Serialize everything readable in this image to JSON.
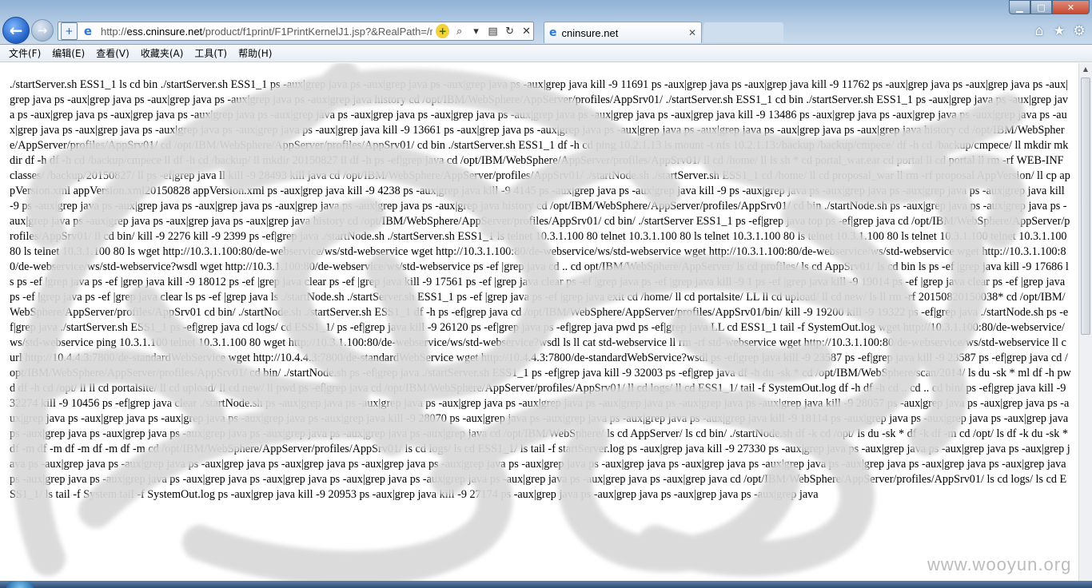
{
  "browser": {
    "url": "http://ess.cninsure.net/product/f1print/F1PrintKernelJ1.jsp?&RealPath=/roc",
    "url_domain": "ess.cninsure.net",
    "tab_title": "cninsure.net"
  },
  "menu": {
    "items": [
      "文件(F)",
      "编辑(E)",
      "查看(V)",
      "收藏夹(A)",
      "工具(T)",
      "帮助(H)"
    ]
  },
  "content": {
    "text": "./startServer.sh ESS1_1 ls cd bin ./startServer.sh ESS1_1 ps -aux|grep java ps -aux|grep java ps -aux|grep java ps -aux|grep java kill -9 11691 ps -aux|grep java ps -aux|grep java kill -9 11762 ps -aux|grep java ps -aux|grep java ps -aux|grep java ps -aux|grep java ps -aux|grep java ps -aux|grep java ps -aux|grep java history cd /opt/IBM/WebSphere/AppServer/profiles/AppSrv01/ ./startServer.sh ESS1_1 cd bin ./startServer.sh ESS1_1 ps -aux|grep java ps -aux|grep java ps -aux|grep java ps -aux|grep java ps -aux|grep java ps -aux|grep java ps -aux|grep java ps -aux|grep java ps -aux|grep java ps -aux|grep java ps -aux|grep java kill -9 13486 ps -aux|grep java ps -aux|grep java ps -aux|grep java ps -aux|grep java ps -aux|grep java ps -aux|grep java ps -aux|grep java ps -aux|grep java kill -9 13661 ps -aux|grep java ps -aux|grep java ps -aux|grep java ps -aux|grep java ps -aux|grep java ps -aux|grep java history cd /opt/IBM/WebSphere/AppServer/profiles/AppSrv01/ cd /opt/IBM/WebSphere/AppServer/profiles/AppSrv01/ cd bin ./startServer.sh ESS1_1 df -h cd ping 10.2.1.13 ls mount -t nfs 10.2.1.13:/backup /backup/cmpece/ df -h cd /backup/cmpece/ ll mkdir mkdir df -h df -h cd /backup/cmpece ll df -h cd /backup/ ll mkdir 20150827 ll df -h ps -ef|grep java cd /opt/IBM/WebSphere/AppServer/profiles/AppSrv01/ ll cd /home/ ll ls sh * cd portal_war.ear cd portal ll cd portal ll rm -rf WEB-INF classes/ /backup/20150827/ ll ps -ef|grep java ll kill -9 28493 kill java cd /opt/IBM/WebSphere/AppServer/profiles/AppSrv01/ ./startNode.sh ./startServer.sh ESS1_1 cd /home/ ll cd proposal_war ll rm -rf proposal AppVersion/ ll cp appVersion.xml appVersion.xml20150828 appVersion.xml ps -aux|grep java kill -9 4238 ps -aux|grep java kill -9 4145 ps -aux|grep java ps -aux|grep java kill -9 ps -aux|grep java ps -aux|grep java ps -aux|grep java ps -aux|grep java kill -9 ps -aux|grep java ps -aux|grep java ps -aux|grep java ps -aux|grep java ps -aux|grep java ps -aux|grep java history cd /opt/IBM/WebSphere/AppServer/profiles/AppSrv01/ cd bin ./startNode.sh ps -aux|grep java ps -aux|grep java ps -aux|grep java ps -aux|grep java ps -aux|grep java ps -aux|grep java history cd /opt/IBM/WebSphere/AppServer/profiles/AppSrv01/ cd bin/ ./startServer ESS1_1 ps -ef|grep java top ps -ef|grep java cd /opt/IBM/WebSphere/AppServer/profiles/AppSrv01/ ll cd bin/ kill -9 2276 kill -9 2399 ps -ef|grep java ./startNode.sh ./startServer.sh ESS1_1 ls telnet 10.3.1.100 80 telnet 10.3.1.100 80 ls telnet 10.3.1.100 80 ls telnet 10.3.1.100 80 ls telnet 10.3.1.100 telnet 10.3.1.100 80 ls telnet 10.3.1.100 80 ls wget http://10.3.1.100:80/de-webservice/ws/std-webservice wget http://10.3.1.100:80/de-webservice/ws/std-webservice wget http://10.3.1.100:80/de-webservice/ws/std-webservice wget http://10.3.1.100:80/de-webservice/ws/std-webservice?wsdl wget http://10.3.1.100:80/de-webservice/ws/std-webservice ps -ef |grep java cd .. cd opt/IBM/WebSphere/AppServer/ ls cd profiles/ ls cd AppSrv01/ ls cd bin ls ps -ef |grep java kill -9 17686 ls ps -ef |grep java ps -ef |grep java kill -9 18012 ps -ef |grep java clear ps -ef |grep java kill -9 17561 ps -ef |grep java clear ps -ef |grep java ps -ef |grep java kill -9 1 ps -ef |grep java kill -9 19014 ps -ef |grep java clear ps -ef |grep java ps -ef |grep java ps -ef |grep java clear ls ps -ef |grep java ls ./startNode.sh ./startServer.sh ESS1_1 ps -ef |grep java ps -ef |grep java exit cd /home/ ll cd portalsite/ LL ll cd upload/ ll cd new/ ls ll rm -rf 20150820150038* cd /opt/IBM/WebSphere/AppServer/profiles/AppSrv01 cd bin/ ./startNode.sh ./startServer.sh ESS1_1 df -h ps -ef|grep java cd /opt/IBM/WebSphere/AppServer/profiles/AppSrv01/bin/ kill -9 19200 kill -9 19322 ps -ef|grep java ./startNode.sh ps -ef|grep java ./startServer.sh ESS1_1 ps -ef|grep java cd logs/ cd ESS1_1/ ps -ef|grep java kill -9 26120 ps -ef|grep java ps -ef|grep java pwd ps -ef|grep java LL cd ESS1_1 tail -f SystemOut.log wget http://10.3.1.100:80/de-webservice/ws/std-webservice ping 10.3.1.100 telnet 10.3.1.100 80 wget http://10.3.1.100:80/de-webservice/ws/std-webservice?wsdl ls ll cat std-webservice ll rm -rf std-webservice wget http://10.3.1.100:80/de-webservice/ws/std-webservice ll curl http://10.4.4.3:7800/de-standardWebService wget http://10.4.4.3:7800/de-standardWebService wget http://10.4.4.3:7800/de-standardWebService?wsdl ps -ef|grep java kill -9 23587 ps -ef|grep java kill -9 23587 ps -ef|grep java cd /opt/IBM/WebSphere/AppServer/profiles/AppSrv01/ cd bin/ ./startNode.sh ps -ef|grep java ./startServer.sh ESS1_1 ps -ef|grep java kill -9 32003 ps -ef|grep java df -h du -sk * cd /opt/IBM/WebSphere/scan/2014/ ls du -sk * ml df -h pwd df -h cd /opt/ ll ll cd portalsite/ ll cd upload/ ll cd new/ ll pwd ps -ef|grep java cd /opt/IBM/WebSphere/AppServer/profiles/AppSrv01/ ll cd logs/ ll cd ESS1_1/ tail -f SystemOut.log df -h df -h cd .. cd .. cd bin/ ps -ef|grep java kill -9 32274 kill -9 10456 ps -ef|grep java clear ./startNode.sh ps -aux|grep java ps -aux|grep java ps -aux|grep java ps -aux|grep java ps -aux|grep java ps -aux|grep java ps -aux|grep java kill -9 28057 ps -aux|grep java ps -aux|grep java ps -aux|grep java ps -aux|grep java ps -aux|grep java ps -aux|grep java ps -aux|grep java kill -9 28070 ps -aux|grep java ps -aux|grep java ps -aux|grep java ps -aux|grep java kill -9 18114 ps -aux|grep java ps -aux|grep java ps -aux|grep java ps -aux|grep java ps -aux|grep java ps -aux|grep java ps -aux|grep java ps -aux|grep java ps -aux|grep java cd /opt/IBM/WebSphere/ ls cd AppServer/ ls cd bin/ ./startNode.sh df -k cd /opt/ ls du -sk * df -k df -m cd /opt/ ls df -k du -sk * df -m df -m df -m df -m df -m cd /opt/IBM/WebSphere/AppServer/profiles/AppSrv01/ ls cd logs/ ls cd ESS1_1/ ls tail -f startServer.log ps -aux|grep java kill -9 27330 ps -aux|grep java ps -aux|grep java ps -aux|grep java ps -aux|grep java ps -aux|grep java ps -aux|grep java ps -aux|grep java ps -aux|grep java ps -aux|grep java ps -aux|grep java ps -aux|grep java ps -aux|grep java ps -aux|grep java ps -aux|grep java ps -aux|grep java ps -aux|grep java ps -aux|grep java ps -aux|grep java ps -aux|grep java ps -aux|grep java ps -aux|grep java ps -aux|grep java ps -aux|grep java ps -aux|grep java ps -aux|grep java ps -aux|grep java cd /opt/IBM/WebSphere/AppServer/profiles/AppSrv01/ ls cd logs/ ls cd ESS1_1/ ls tail -f System tail -f SystemOut.log ps -aux|grep java kill -9 20953 ps -aux|grep java kill -9 27174 ps -aux|grep java ps -aux|grep java ps -aux|grep java ps -aux|grep java"
  },
  "watermark": "www.wooyun.org",
  "icons": {
    "back": "back-arrow-icon",
    "forward": "forward-arrow-icon",
    "compat": "compatibility-view-icon",
    "site": "ie-page-icon",
    "load": "load-icon",
    "search": "search-icon",
    "refresh": "refresh-icon",
    "stop": "stop-icon",
    "home": "home-icon",
    "favorites": "star-icon",
    "tools": "gear-icon"
  },
  "colors": {
    "titlebar": "#b9cfe6",
    "accent": "#1f5fc4",
    "text": "#000000"
  }
}
